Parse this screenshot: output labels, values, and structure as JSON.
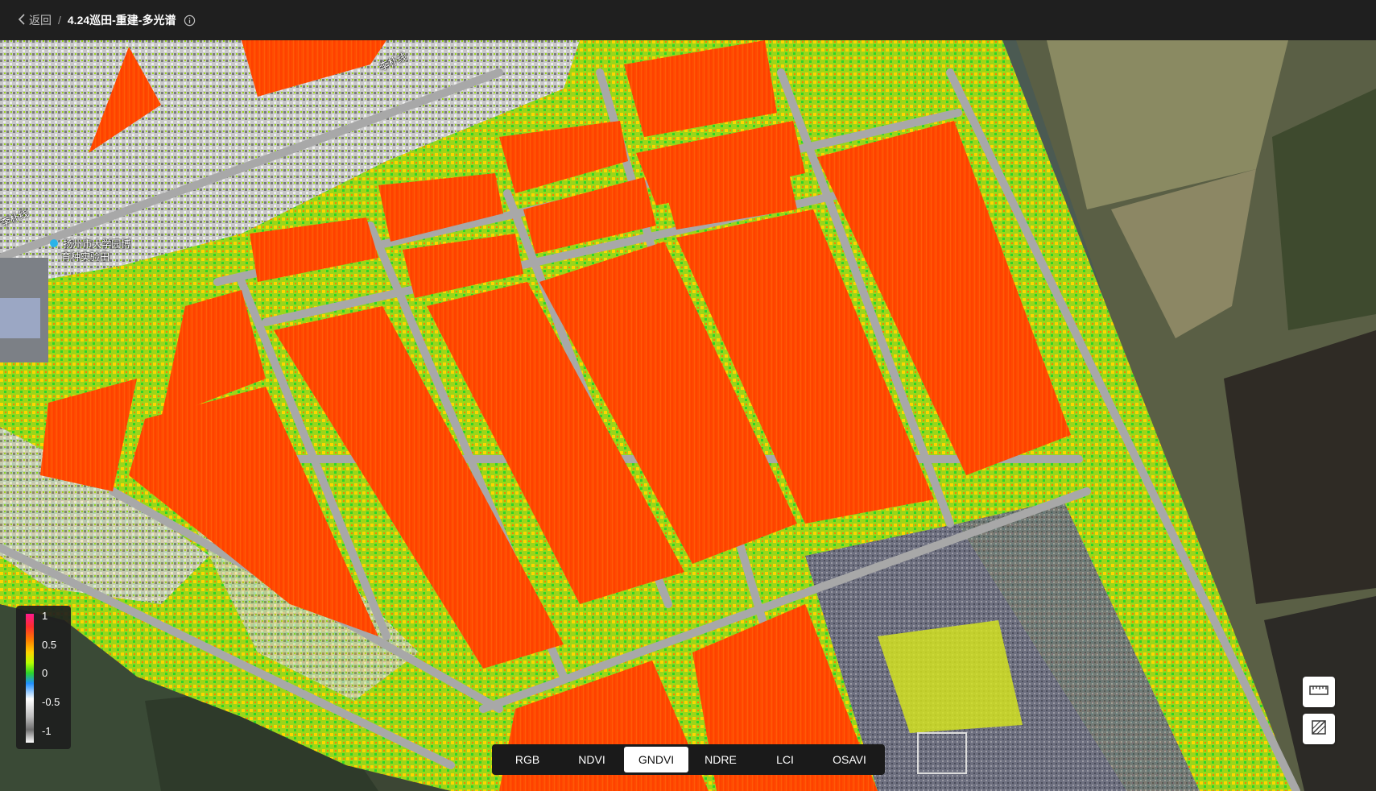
{
  "header": {
    "back_label": "返回",
    "separator": "/",
    "title": "4.24巡田-重建-多光谱"
  },
  "map": {
    "road_label_1": "李朴线",
    "road_label_2": "李朴线",
    "poi_label_1": "扬州市大学园博",
    "poi_label_2": "育种实验田"
  },
  "legend": {
    "ticks": [
      "1",
      "0.5",
      "0",
      "-0.5",
      "-1"
    ]
  },
  "index_tabs": {
    "items": [
      "RGB",
      "NDVI",
      "GNDVI",
      "NDRE",
      "LCI",
      "OSAVI"
    ],
    "active": "GNDVI"
  },
  "colors": {
    "field_high": "#ff4a00",
    "vegetation_mid": "#8fd61a",
    "road_gray": "#9a9a9a",
    "header_bg": "#1f1f1f"
  }
}
